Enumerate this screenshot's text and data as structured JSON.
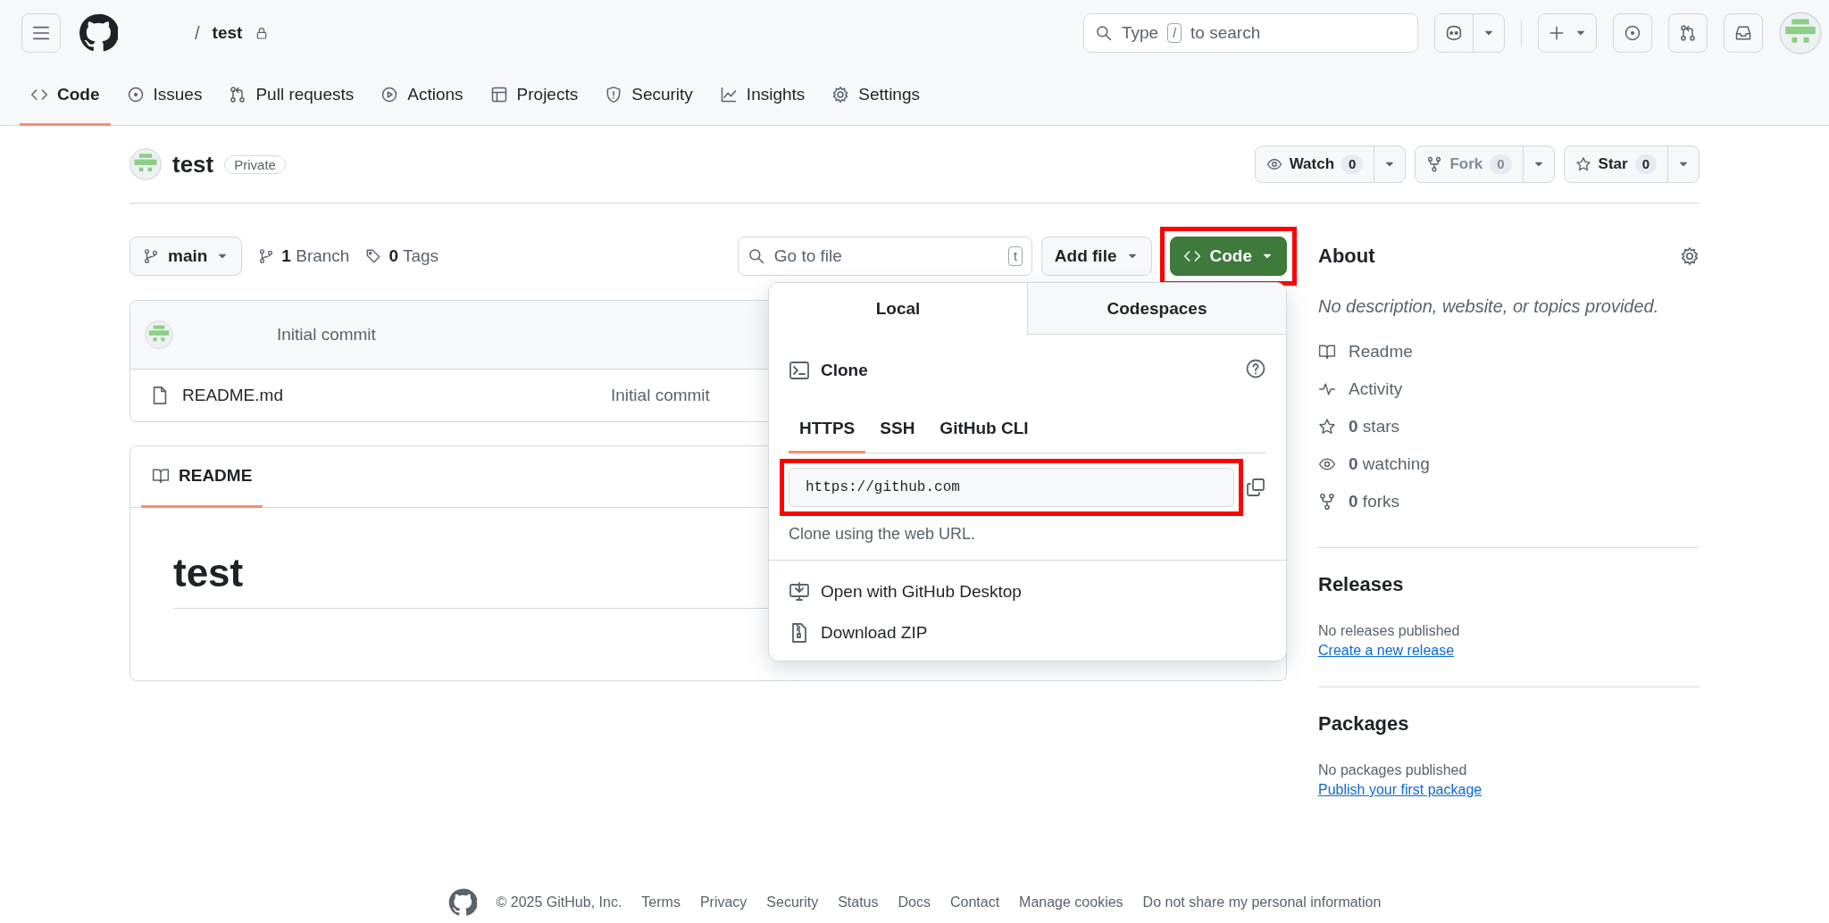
{
  "header": {
    "separator": "/",
    "repo_name": "test",
    "search": {
      "prefix": "Type",
      "key": "/",
      "suffix": "to search"
    }
  },
  "nav_tabs": [
    {
      "label": "Code",
      "selected": true
    },
    {
      "label": "Issues",
      "selected": false
    },
    {
      "label": "Pull requests",
      "selected": false
    },
    {
      "label": "Actions",
      "selected": false
    },
    {
      "label": "Projects",
      "selected": false
    },
    {
      "label": "Security",
      "selected": false
    },
    {
      "label": "Insights",
      "selected": false
    },
    {
      "label": "Settings",
      "selected": false
    }
  ],
  "repo": {
    "name": "test",
    "visibility": "Private",
    "actions": [
      {
        "label": "Watch",
        "count": "0",
        "disabled": false
      },
      {
        "label": "Fork",
        "count": "0",
        "disabled": true
      },
      {
        "label": "Star",
        "count": "0",
        "disabled": false
      }
    ]
  },
  "toolbar": {
    "branch": "main",
    "branches": {
      "count": "1",
      "label": "Branch"
    },
    "tags": {
      "count": "0",
      "label": "Tags"
    },
    "go_to_file": {
      "placeholder": "Go to file",
      "key": "t"
    },
    "add_file": "Add file",
    "code_button": {
      "label": "Code",
      "highlighted": true
    }
  },
  "files": {
    "latest_commit": "Initial commit",
    "rows": [
      {
        "name": "README.md",
        "commit": "Initial commit"
      }
    ]
  },
  "readme": {
    "tab": "README",
    "heading": "test"
  },
  "clone_menu": {
    "tabs": [
      {
        "label": "Local",
        "selected": true
      },
      {
        "label": "Codespaces",
        "selected": false
      }
    ],
    "title": "Clone",
    "protocols": [
      {
        "label": "HTTPS",
        "selected": true
      },
      {
        "label": "SSH",
        "selected": false
      },
      {
        "label": "GitHub CLI",
        "selected": false
      }
    ],
    "url": {
      "value": "https://github.com",
      "highlighted": true
    },
    "hint": "Clone using the web URL.",
    "actions": [
      {
        "label": "Open with GitHub Desktop"
      },
      {
        "label": "Download ZIP"
      }
    ]
  },
  "about": {
    "title": "About",
    "description": "No description, website, or topics provided.",
    "items": [
      {
        "label": "Readme"
      },
      {
        "label": "Activity"
      },
      {
        "count": "0",
        "label": "stars"
      },
      {
        "count": "0",
        "label": "watching"
      },
      {
        "count": "0",
        "label": "forks"
      }
    ]
  },
  "sections": [
    {
      "title": "Releases",
      "empty": "No releases published",
      "link": "Create a new release"
    },
    {
      "title": "Packages",
      "empty": "No packages published",
      "link": "Publish your first package"
    }
  ],
  "footer": {
    "copyright": "© 2025 GitHub, Inc.",
    "links": [
      "Terms",
      "Privacy",
      "Security",
      "Status",
      "Docs",
      "Contact",
      "Manage cookies",
      "Do not share my personal information"
    ]
  }
}
